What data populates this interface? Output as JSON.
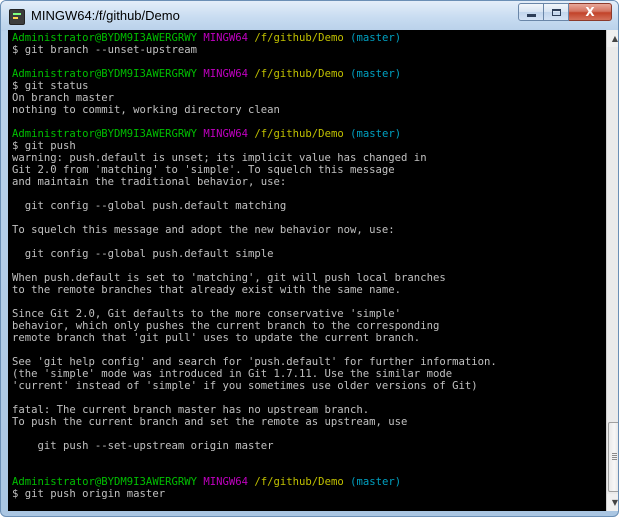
{
  "window": {
    "title": "MINGW64:/f/github/Demo",
    "icon": "terminal-icon",
    "controls": {
      "minimize": "minimize-icon",
      "maximize": "maximize-icon",
      "close": "close-icon",
      "close_label": "X"
    }
  },
  "terminal": {
    "colors": {
      "background": "#000000",
      "text": "#c0c0c0",
      "user": "#00bf00",
      "mingw": "#c000c0",
      "path": "#c0c000",
      "branch": "#00a0c0"
    },
    "prompt": {
      "user": "Administrator@BYDM9I3AWERGRWY",
      "env": "MINGW64",
      "path": "/f/github/Demo",
      "branch": "(master)"
    },
    "lines": [
      {
        "type": "prompt"
      },
      {
        "type": "text",
        "text": "$ git branch --unset-upstream"
      },
      {
        "type": "text",
        "text": ""
      },
      {
        "type": "prompt"
      },
      {
        "type": "text",
        "text": "$ git status"
      },
      {
        "type": "text",
        "text": "On branch master"
      },
      {
        "type": "text",
        "text": "nothing to commit, working directory clean"
      },
      {
        "type": "text",
        "text": ""
      },
      {
        "type": "prompt"
      },
      {
        "type": "text",
        "text": "$ git push"
      },
      {
        "type": "text",
        "text": "warning: push.default is unset; its implicit value has changed in"
      },
      {
        "type": "text",
        "text": "Git 2.0 from 'matching' to 'simple'. To squelch this message"
      },
      {
        "type": "text",
        "text": "and maintain the traditional behavior, use:"
      },
      {
        "type": "text",
        "text": ""
      },
      {
        "type": "text",
        "text": "  git config --global push.default matching"
      },
      {
        "type": "text",
        "text": ""
      },
      {
        "type": "text",
        "text": "To squelch this message and adopt the new behavior now, use:"
      },
      {
        "type": "text",
        "text": ""
      },
      {
        "type": "text",
        "text": "  git config --global push.default simple"
      },
      {
        "type": "text",
        "text": ""
      },
      {
        "type": "text",
        "text": "When push.default is set to 'matching', git will push local branches"
      },
      {
        "type": "text",
        "text": "to the remote branches that already exist with the same name."
      },
      {
        "type": "text",
        "text": ""
      },
      {
        "type": "text",
        "text": "Since Git 2.0, Git defaults to the more conservative 'simple'"
      },
      {
        "type": "text",
        "text": "behavior, which only pushes the current branch to the corresponding"
      },
      {
        "type": "text",
        "text": "remote branch that 'git pull' uses to update the current branch."
      },
      {
        "type": "text",
        "text": ""
      },
      {
        "type": "text",
        "text": "See 'git help config' and search for 'push.default' for further information."
      },
      {
        "type": "text",
        "text": "(the 'simple' mode was introduced in Git 1.7.11. Use the similar mode"
      },
      {
        "type": "text",
        "text": "'current' instead of 'simple' if you sometimes use older versions of Git)"
      },
      {
        "type": "text",
        "text": ""
      },
      {
        "type": "text",
        "text": "fatal: The current branch master has no upstream branch."
      },
      {
        "type": "text",
        "text": "To push the current branch and set the remote as upstream, use"
      },
      {
        "type": "text",
        "text": ""
      },
      {
        "type": "text",
        "text": "    git push --set-upstream origin master"
      },
      {
        "type": "text",
        "text": ""
      },
      {
        "type": "text",
        "text": ""
      },
      {
        "type": "prompt"
      },
      {
        "type": "text",
        "text": "$ git push origin master"
      }
    ]
  },
  "scrollbar": {
    "up_arrow": "scroll-up-arrow-icon",
    "down_arrow": "scroll-down-arrow-icon",
    "position_fraction": 1.0
  }
}
